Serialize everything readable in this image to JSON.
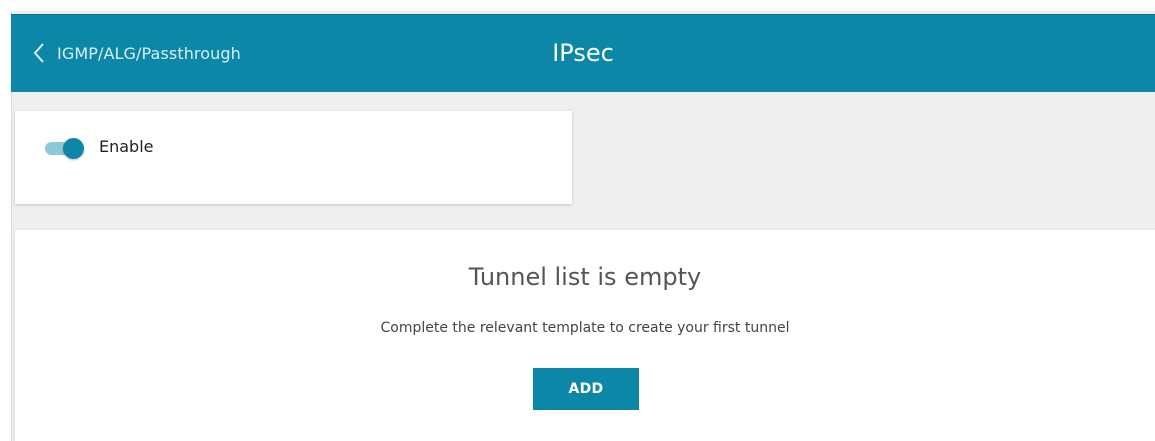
{
  "header": {
    "back_label": "IGMP/ALG/Passthrough",
    "title": "IPsec",
    "back_icon": "chevron-left-icon"
  },
  "settings": {
    "enable_label": "Enable",
    "enable_state": "on"
  },
  "tunnels": {
    "empty_title": "Tunnel list is empty",
    "empty_message": "Complete the relevant template to create your first tunnel",
    "add_label": "ADD"
  },
  "colors": {
    "accent": "#0d87a8",
    "background": "#efefef",
    "toggle_track": "#8ec9da"
  }
}
